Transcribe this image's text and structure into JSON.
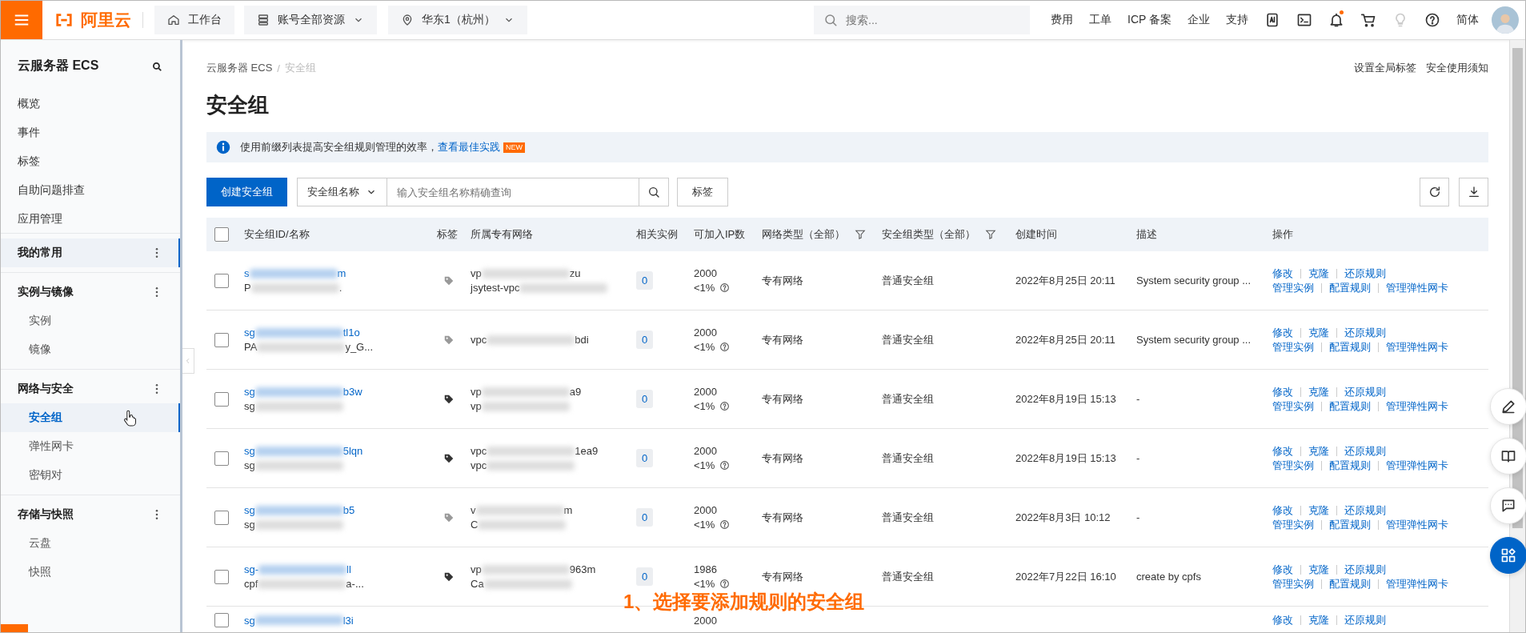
{
  "topbar": {
    "logo": "阿里云",
    "nav": [
      {
        "label": "工作台",
        "kind": "home"
      },
      {
        "label": "账号全部资源",
        "kind": "dropdown"
      },
      {
        "label": "华东1（杭州）",
        "kind": "region"
      }
    ],
    "search": {
      "placeholder": "搜索..."
    },
    "links": [
      "费用",
      "工单",
      "ICP 备案",
      "企业",
      "支持"
    ],
    "icons": [
      {
        "kind": "app"
      },
      {
        "kind": "terminal"
      },
      {
        "kind": "bell",
        "badge": true
      },
      {
        "kind": "cart"
      },
      {
        "kind": "bulb",
        "disabled": true
      },
      {
        "kind": "help"
      }
    ],
    "language": "简体"
  },
  "sidebar": {
    "title": "云服务器 ECS",
    "items": [
      {
        "label": "概览",
        "selected": false
      },
      {
        "label": "事件",
        "selected": false
      },
      {
        "label": "标签",
        "selected": false
      },
      {
        "label": "自助问题排查",
        "selected": false
      },
      {
        "label": "应用管理",
        "selected": false
      }
    ],
    "groups": [
      {
        "label": "我的常用",
        "selected": true
      },
      {
        "label": "实例与镜像",
        "selected": false,
        "children": [
          {
            "label": "实例",
            "selected": false
          },
          {
            "label": "镜像",
            "selected": false
          }
        ]
      },
      {
        "label": "网络与安全",
        "selected": false,
        "children": [
          {
            "label": "安全组",
            "selected": true
          },
          {
            "label": "弹性网卡",
            "selected": false
          },
          {
            "label": "密钥对",
            "selected": false
          }
        ]
      },
      {
        "label": "存储与快照",
        "selected": false,
        "children": [
          {
            "label": "云盘",
            "selected": false
          },
          {
            "label": "快照",
            "selected": false
          }
        ]
      }
    ]
  },
  "breadcrumb": {
    "items": [
      "云服务器 ECS",
      "安全组"
    ],
    "separator": "/"
  },
  "header_links": [
    "设置全局标签",
    "安全使用须知"
  ],
  "title": "安全组",
  "notice": {
    "text": "使用前缀列表提高安全组规则管理的效率，",
    "link": "查看最佳实践",
    "badge": "NEW"
  },
  "toolbar": {
    "create": "创建安全组",
    "filter_field": "安全组名称",
    "search": {
      "placeholder": "输入安全组名称精确查询"
    },
    "tag_button": "标签"
  },
  "table": {
    "select_all": {
      "checked": false
    },
    "columns": [
      {
        "label": "安全组ID/名称"
      },
      {
        "label": "标签"
      },
      {
        "label": "所属专有网络"
      },
      {
        "label": "相关实例"
      },
      {
        "label": "可加入IP数"
      },
      {
        "label": "网络类型（全部）",
        "filter": true
      },
      {
        "label": "安全组类型（全部）",
        "filter": true
      },
      {
        "label": "创建时间"
      },
      {
        "label": "描述"
      },
      {
        "label": "操作"
      }
    ],
    "rows": [
      {
        "checked": false,
        "id": [
          "s",
          "m"
        ],
        "name": [
          "P",
          "."
        ],
        "tagged": false,
        "vpc": [
          "vp",
          "zu"
        ],
        "vpc_name": [
          "jsytest-vpc"
        ],
        "instances": "0",
        "ip_count": "2000",
        "ip_usage": "<1%",
        "network_type": "专有网络",
        "group_type": "普通安全组",
        "created": "2022年8月25日 20:11",
        "description": "System security group ...",
        "actions": [
          [
            "修改",
            "克隆",
            "还原规则"
          ],
          [
            "管理实例",
            "配置规则",
            "管理弹性网卡"
          ]
        ]
      },
      {
        "checked": false,
        "id": [
          "sg",
          "tl1o"
        ],
        "name": [
          "PA",
          "y_G..."
        ],
        "tagged": false,
        "vpc": [
          "vpc",
          "bdi"
        ],
        "instances": "0",
        "ip_count": "2000",
        "ip_usage": "<1%",
        "network_type": "专有网络",
        "group_type": "普通安全组",
        "created": "2022年8月25日 20:11",
        "description": "System security group ...",
        "actions": [
          [
            "修改",
            "克隆",
            "还原规则"
          ],
          [
            "管理实例",
            "配置规则",
            "管理弹性网卡"
          ]
        ]
      },
      {
        "checked": false,
        "id": [
          "sg",
          "b3w"
        ],
        "name": [
          "sg"
        ],
        "tagged": true,
        "vpc": [
          "vp",
          "a9"
        ],
        "vpc_name": [
          "vp"
        ],
        "instances": "0",
        "ip_count": "2000",
        "ip_usage": "<1%",
        "network_type": "专有网络",
        "group_type": "普通安全组",
        "created": "2022年8月19日 15:13",
        "description": "-",
        "actions": [
          [
            "修改",
            "克隆",
            "还原规则"
          ],
          [
            "管理实例",
            "配置规则",
            "管理弹性网卡"
          ]
        ]
      },
      {
        "checked": false,
        "id": [
          "sg",
          "5lqn"
        ],
        "name": [
          "sg"
        ],
        "tagged": true,
        "vpc": [
          "vpc",
          "1ea9"
        ],
        "vpc_name": [
          "vpc"
        ],
        "instances": "0",
        "ip_count": "2000",
        "ip_usage": "<1%",
        "network_type": "专有网络",
        "group_type": "普通安全组",
        "created": "2022年8月19日 15:13",
        "description": "-",
        "actions": [
          [
            "修改",
            "克隆",
            "还原规则"
          ],
          [
            "管理实例",
            "配置规则",
            "管理弹性网卡"
          ]
        ]
      },
      {
        "checked": false,
        "id": [
          "sg",
          "b5"
        ],
        "name": [
          "sg"
        ],
        "tagged": false,
        "vpc": [
          "v",
          "m"
        ],
        "vpc_name": [
          "C"
        ],
        "instances": "0",
        "ip_count": "2000",
        "ip_usage": "<1%",
        "network_type": "专有网络",
        "group_type": "普通安全组",
        "created": "2022年8月3日 10:12",
        "description": "-",
        "actions": [
          [
            "修改",
            "克隆",
            "还原规则"
          ],
          [
            "管理实例",
            "配置规则",
            "管理弹性网卡"
          ]
        ]
      },
      {
        "checked": false,
        "id": [
          "sg-",
          "ll"
        ],
        "name": [
          "cpf",
          "a-..."
        ],
        "tagged": true,
        "vpc": [
          "vp",
          "963m"
        ],
        "vpc_name": [
          "Ca"
        ],
        "instances": "0",
        "ip_count": "1986",
        "ip_usage": "<1%",
        "network_type": "专有网络",
        "group_type": "普通安全组",
        "created": "2022年7月22日 16:10",
        "description": "create by cpfs",
        "actions": [
          [
            "修改",
            "克隆",
            "还原规则"
          ],
          [
            "管理实例",
            "配置规则",
            "管理弹性网卡"
          ]
        ]
      },
      {
        "checked": false,
        "id": [
          "sg",
          "l3i"
        ],
        "ip_count": "2000",
        "actions": [
          [
            "修改",
            "克隆",
            "还原规则"
          ]
        ]
      }
    ]
  },
  "caption": "1、选择要添加规则的安全组",
  "float_buttons": [
    {
      "kind": "edit"
    },
    {
      "kind": "book"
    },
    {
      "kind": "chat"
    },
    {
      "kind": "apps",
      "primary": true
    }
  ]
}
